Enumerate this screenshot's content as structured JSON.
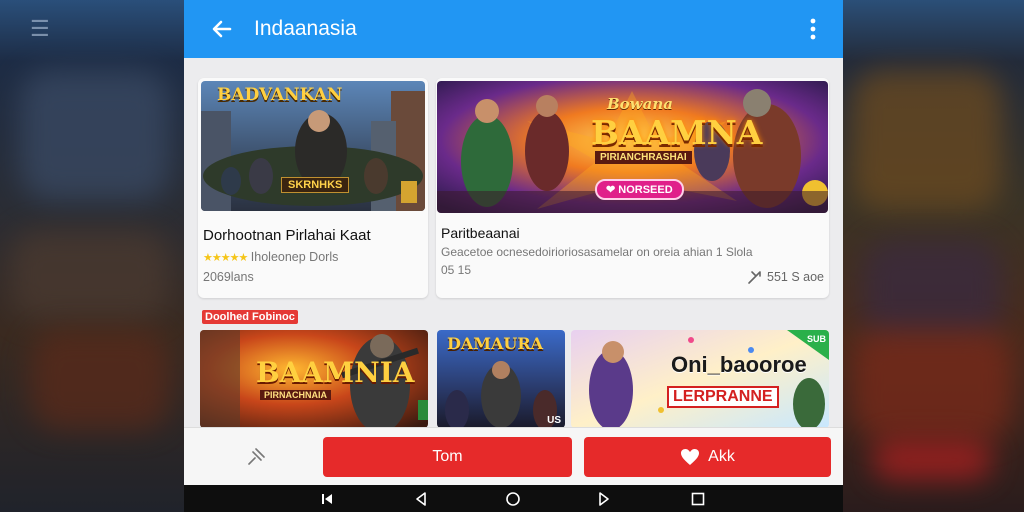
{
  "app": {
    "title": "Indaanasia"
  },
  "colors": {
    "appbar": "#2196f3",
    "accent_red": "#e62a2a",
    "star": "#f5c518"
  },
  "icons": {
    "back": "arrow-left-icon",
    "more": "more-vertical-icon",
    "pin": "pin-icon",
    "heart": "heart-icon",
    "share": "share-icon"
  },
  "featured": [
    {
      "banner_top": "BADVANKAN",
      "banner_bottom": "SKRNHKS",
      "title": "Dorhootnan Pirlahai Kaat",
      "rating_text": "Iholeonep Dorls",
      "meta": "2069lans"
    },
    {
      "banner_top": "Bowana",
      "banner_main": "BAAMNA",
      "banner_sub": "PIRIANCHRASHAI",
      "badge": "NORSEED",
      "title": "Paritbeaanai",
      "description": "Geacetoe ocnesedoirioriosasamelar on oreia ahian 1 Slola",
      "meta": "05 15",
      "share_text": "551 S aoe"
    }
  ],
  "section": {
    "label": "Doolhed Fobinoc"
  },
  "grid": [
    {
      "banner_main": "BAAMNIA",
      "banner_sub": "PIRNACHNAIA"
    },
    {
      "banner_main": "DAMAURA",
      "corner": "US"
    },
    {
      "banner_main": "Oni_baooroe",
      "banner_sub": "LERPRANNE",
      "corner": "SUB"
    }
  ],
  "actions": {
    "primary": "Tom",
    "secondary": "Akk"
  },
  "nav": {
    "items": [
      "nav-skip",
      "nav-back",
      "nav-home",
      "nav-play",
      "nav-recents"
    ]
  }
}
